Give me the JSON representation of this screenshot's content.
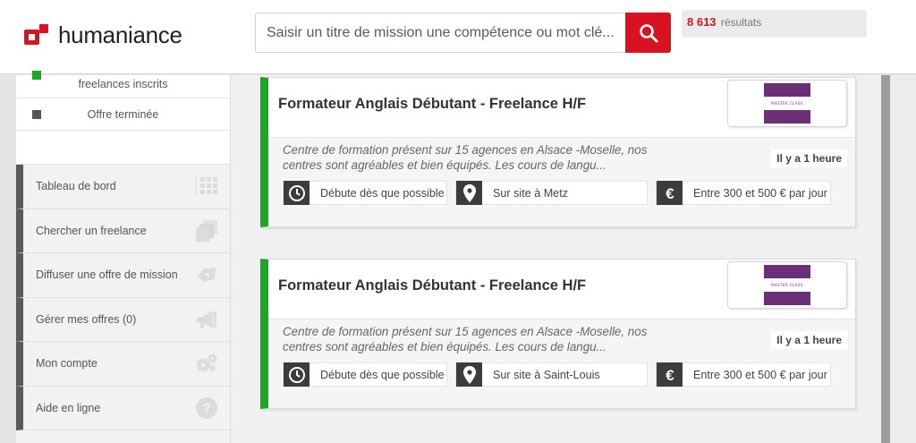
{
  "header": {
    "logo_text": "humaniance",
    "search_placeholder": "Saisir un titre de mission une compétence ou mot clé...",
    "results_count": "8 613",
    "results_label": "résultats"
  },
  "sidebar": {
    "legend": [
      {
        "label": "freelances inscrits",
        "color": "#19a81f"
      },
      {
        "label": "Offre terminée",
        "color": "#555555"
      }
    ],
    "nav": [
      {
        "label": "Tableau de bord",
        "icon": "dashboard-grid-icon"
      },
      {
        "label": "Chercher un freelance",
        "icon": "stacked-cards-icon"
      },
      {
        "label": "Diffuser une offre de mission",
        "icon": "broadcast-icon"
      },
      {
        "label": "Gérer mes offres (0)",
        "icon": "megaphone-icon"
      },
      {
        "label": "Mon compte",
        "icon": "gears-icon"
      },
      {
        "label": "Aide en ligne",
        "icon": "help-circle-icon"
      }
    ]
  },
  "offers": [
    {
      "title": "Formateur Anglais Débutant - Freelance H/F",
      "description": "Centre de formation présent sur 15 agences en Alsace -Moselle, nos centres sont agréables et bien équipés. Les cours de langu...",
      "time": "Il y a 1 heure",
      "start": "Débute dès que possible",
      "location": "Sur site à Metz",
      "rate": "Entre 300 et 500 € par jour",
      "company_logo_text": "MASTER CLASS"
    },
    {
      "title": "Formateur Anglais Débutant - Freelance H/F",
      "description": "Centre de formation présent sur 15 agences en Alsace -Moselle, nos centres sont agréables et bien équipés. Les cours de langu...",
      "time": "Il y a 1 heure",
      "start": "Débute dès que possible",
      "location": "Sur site à Saint-Louis",
      "rate": "Entre 300 et 500 € par jour",
      "company_logo_text": "MASTER CLASS"
    }
  ],
  "colors": {
    "brand_red": "#d8121e",
    "active_green": "#19a81f",
    "logo_purple": "#6b2f78"
  }
}
